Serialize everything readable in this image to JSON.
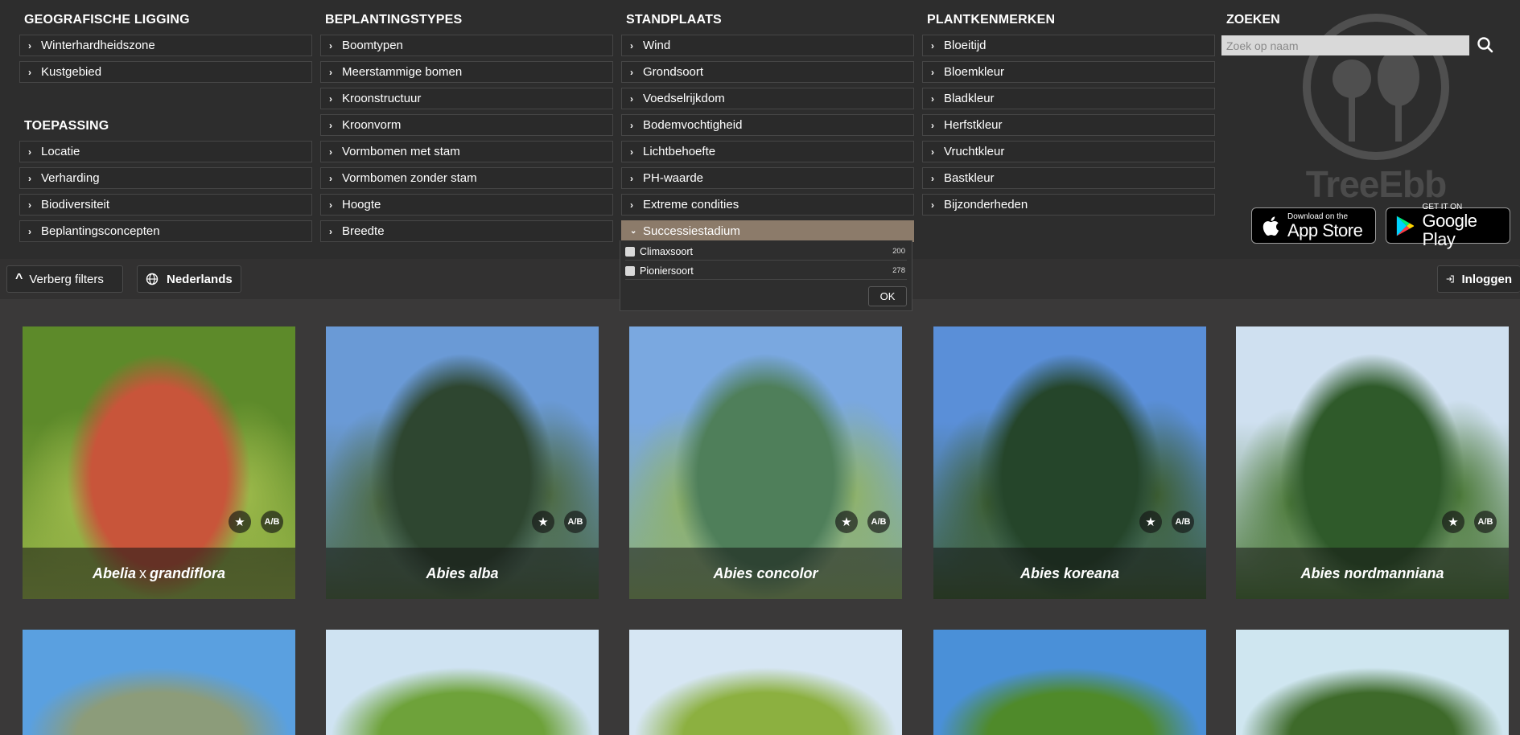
{
  "filters": {
    "geografische": {
      "heading": "GEOGRAFISCHE LIGGING",
      "items": [
        "Winterhardheidszone",
        "Kustgebied"
      ]
    },
    "toepassing": {
      "heading": "TOEPASSING",
      "items": [
        "Locatie",
        "Verharding",
        "Biodiversiteit",
        "Beplantingsconcepten"
      ]
    },
    "beplantingstypes": {
      "heading": "BEPLANTINGSTYPES",
      "items": [
        "Boomtypen",
        "Meerstammige bomen",
        "Kroonstructuur",
        "Kroonvorm",
        "Vormbomen met stam",
        "Vormbomen zonder stam",
        "Hoogte",
        "Breedte"
      ]
    },
    "standplaats": {
      "heading": "STANDPLAATS",
      "items": [
        "Wind",
        "Grondsoort",
        "Voedselrijkdom",
        "Bodemvochtigheid",
        "Lichtbehoefte",
        "PH-waarde",
        "Extreme condities",
        "Successiestadium"
      ],
      "open_item": "Successiestadium",
      "options": [
        {
          "label": "Climaxsoort",
          "count": "200"
        },
        {
          "label": "Pioniersoort",
          "count": "278"
        }
      ],
      "ok_label": "OK"
    },
    "plantkenmerken": {
      "heading": "PLANTKENMERKEN",
      "items": [
        "Bloeitijd",
        "Bloemkleur",
        "Bladkleur",
        "Herfstkleur",
        "Vruchtkleur",
        "Bastkleur",
        "Bijzonderheden"
      ]
    }
  },
  "search": {
    "heading": "ZOEKEN",
    "placeholder": "Zoek op naam",
    "icon": "search-icon"
  },
  "brand": {
    "logo_text": "TreeEbb"
  },
  "badges": {
    "appstore": {
      "small": "Download on the",
      "big": "App Store"
    },
    "googleplay": {
      "small": "GET IT ON",
      "big": "Google Play"
    }
  },
  "toolbar": {
    "hide_filters": "Verberg filters",
    "language": "Nederlands",
    "login": "Inloggen"
  },
  "cards": [
    {
      "name_a": "Abelia",
      "x": "x",
      "name_b": "grandiflora",
      "fraction": "A/B",
      "palette": [
        "#5d8a2a",
        "#c8553a",
        "#9bb84a"
      ]
    },
    {
      "name_a": "Abies alba",
      "x": "",
      "name_b": "",
      "fraction": "A/B",
      "palette": [
        "#6a9ad6",
        "#2e4630",
        "#4d6a43"
      ]
    },
    {
      "name_a": "Abies concolor",
      "x": "",
      "name_b": "",
      "fraction": "A/B",
      "palette": [
        "#7aa8e0",
        "#4f7f5a",
        "#8fb26a"
      ]
    },
    {
      "name_a": "Abies koreana",
      "x": "",
      "name_b": "",
      "fraction": "A/B",
      "palette": [
        "#5a8fd8",
        "#25452a",
        "#3d5e32"
      ]
    },
    {
      "name_a": "Abies nordmanniana",
      "x": "",
      "name_b": "",
      "fraction": "A/B",
      "palette": [
        "#cfe0f0",
        "#2f5a2a",
        "#4d7a3a"
      ]
    }
  ],
  "row2": [
    {
      "palette": [
        "#5aa0e0",
        "#8c9c7a"
      ]
    },
    {
      "palette": [
        "#cfe3f2",
        "#6ea23a"
      ]
    },
    {
      "palette": [
        "#d6e6f3",
        "#8cb040"
      ]
    },
    {
      "palette": [
        "#4a90d8",
        "#4f8a2a"
      ]
    },
    {
      "palette": [
        "#cfe6f0",
        "#3e6a2a"
      ]
    }
  ],
  "colors": {
    "accent": "#8c7b6a",
    "panel": "#2d2d2d",
    "page": "#3a3939"
  }
}
